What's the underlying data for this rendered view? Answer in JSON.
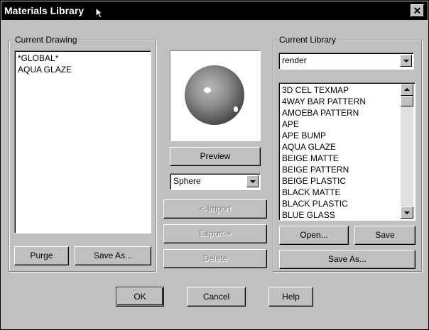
{
  "window": {
    "title": "Materials Library",
    "close_glyph": "✕"
  },
  "current_drawing": {
    "label": "Current Drawing",
    "items": [
      "*GLOBAL*",
      "AQUA GLAZE"
    ],
    "purge_label": "Purge",
    "save_as_label": "Save As..."
  },
  "preview": {
    "button_label": "Preview",
    "shape": "Sphere",
    "import_label": "<-Import",
    "export_label": "Export->",
    "delete_label": "Delete"
  },
  "current_library": {
    "label": "Current Library",
    "library_name": "render",
    "items": [
      "3D CEL TEXMAP",
      "4WAY BAR PATTERN",
      "AMOEBA PATTERN",
      "APE",
      "APE BUMP",
      "AQUA GLAZE",
      "BEIGE MATTE",
      "BEIGE PATTERN",
      "BEIGE PLASTIC",
      "BLACK MATTE",
      "BLACK PLASTIC",
      "BLUE GLASS"
    ],
    "open_label": "Open...",
    "save_label": "Save",
    "save_as_label": "Save As..."
  },
  "footer": {
    "ok_label": "OK",
    "cancel_label": "Cancel",
    "help_label": "Help"
  },
  "colors": {
    "titlebar": "#000000",
    "face": "#c0c0c0",
    "sphere": "#8a8a8a"
  }
}
